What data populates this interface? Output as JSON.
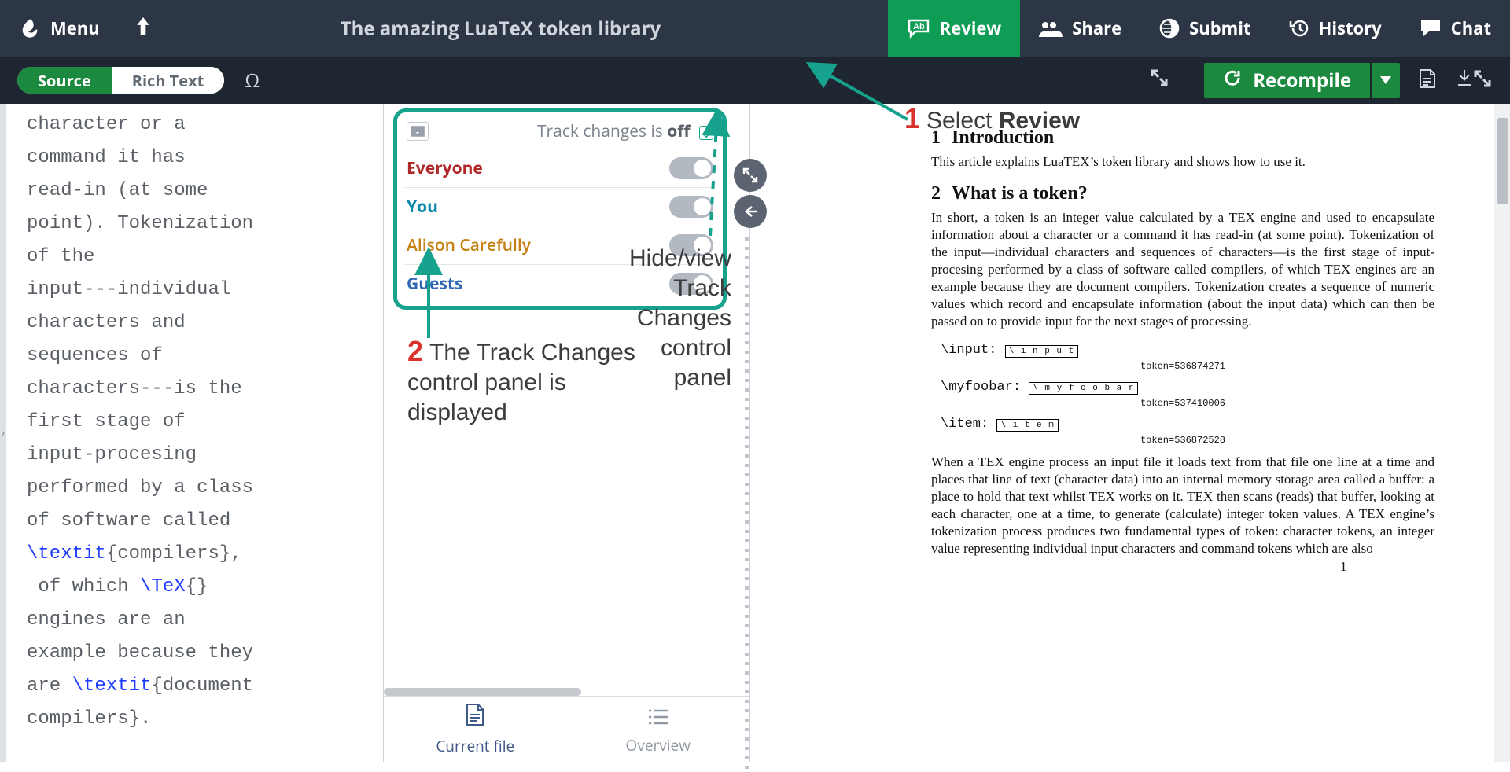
{
  "topbar": {
    "menu": "Menu",
    "title": "The amazing LuaTeX token library",
    "tabs": {
      "review": "Review",
      "share": "Share",
      "submit": "Submit",
      "history": "History",
      "chat": "Chat"
    }
  },
  "subbar": {
    "source": "Source",
    "rich": "Rich Text",
    "omega": "Ω",
    "recompile": "Recompile"
  },
  "editor": {
    "code_plain_1": "character or a\ncommand it has\nread-in (at some\npoint). Tokenization\nof the\ninput---individual\ncharacters and\nsequences of\ncharacters---is the\nfirst stage of\ninput-procesing\nperformed by a class\nof software called\n",
    "code_cmd_1": "\\textit",
    "code_plain_2": "{compilers},\n of which ",
    "code_cmd_2": "\\TeX",
    "code_plain_3": "{}\nengines are an\nexample because they\nare ",
    "code_cmd_3": "\\textit",
    "code_plain_4": "{document\ncompilers}."
  },
  "track_changes": {
    "status_prefix": "Track changes is ",
    "status_state": "off",
    "rows": {
      "everyone": "Everyone",
      "you": "You",
      "alison": "Alison Carefully",
      "guests": "Guests"
    }
  },
  "review_tabs": {
    "current": "Current file",
    "overview": "Overview"
  },
  "pdf": {
    "h1_num": "1",
    "h1": "Introduction",
    "p1": "This article explains LuaTEX’s token library and shows how to use it.",
    "h2_num": "2",
    "h2": "What is a token?",
    "p2": "In short, a token is an integer value calculated by a TEX engine and used to encapsulate information about a character or a command it has read-in (at some point). Tokenization of the input—individual characters and sequences of characters—is the first stage of input-procesing performed by a class of software called compilers, of which TEX engines are an example because they are document compilers. Tokenization creates a sequence of numeric values which record and encapsulate information (about the input data) which can then be passed on to provide input for the next stages of processing.",
    "fig1_label": "\\input:",
    "fig1_cap": "token=536874271",
    "fig2_label": "\\myfoobar:",
    "fig2_cap": "token=537410006",
    "fig3_label": "\\item:",
    "fig3_cap": "token=536872528",
    "p3": "When a TEX engine process an input file it loads text from that file one line at a time and places that line of text (character data) into an internal memory storage area called a buffer: a place to hold that text whilst TEX works on it. TEX then scans (reads) that buffer, looking at each character, one at a time, to generate (calculate) integer token values. A TEX engine’s tokenization process produces two fundamental types of token: character tokens, an integer value representing individual input characters and command tokens which are also",
    "page": "1"
  },
  "annotations": {
    "a1": "Select ",
    "a1b": "Review",
    "a2": "The Track Changes control panel is displayed",
    "a3": "Hide/view Track Changes control panel"
  }
}
